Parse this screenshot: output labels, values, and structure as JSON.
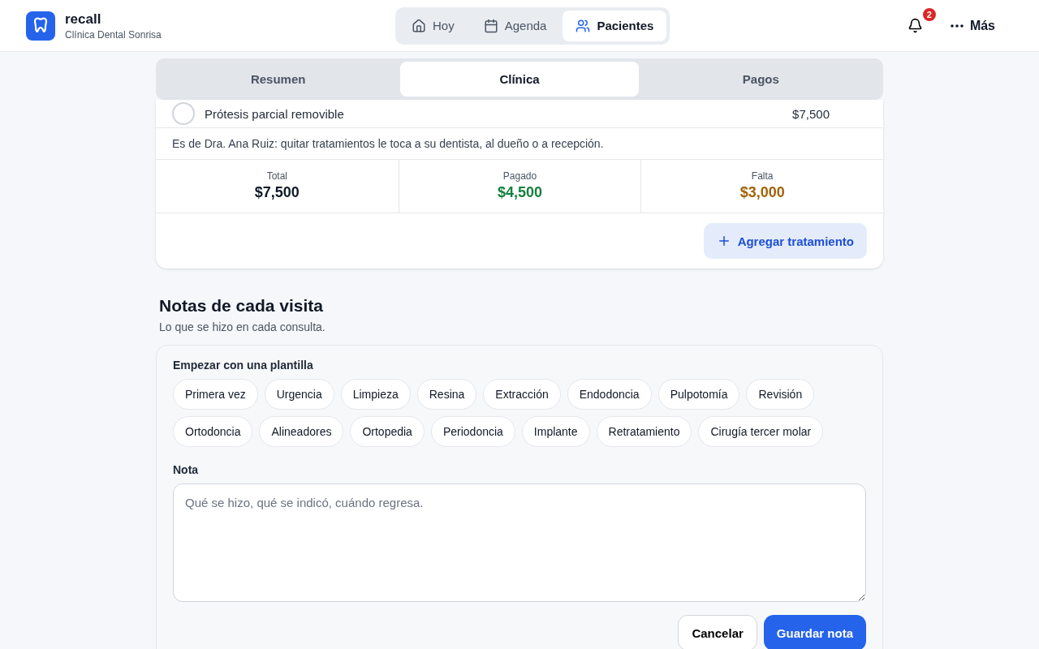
{
  "app": {
    "name": "recall",
    "clinic": "Clínica Dental Sonrisa"
  },
  "nav": [
    {
      "label": "Hoy",
      "kind": "home",
      "selected": false
    },
    {
      "label": "Agenda",
      "kind": "calendar",
      "selected": false
    },
    {
      "label": "Pacientes",
      "kind": "users",
      "selected": true
    }
  ],
  "notifications": {
    "count": "2"
  },
  "more": {
    "label": "Más"
  },
  "section_tabs": [
    {
      "label": "Resumen",
      "selected": false
    },
    {
      "label": "Clínica",
      "selected": true
    },
    {
      "label": "Pagos",
      "selected": false
    }
  ],
  "treatments": [
    {
      "name": "Prótesis parcial removible",
      "price": "$7,500",
      "checked": false
    }
  ],
  "owner_note": "Es de Dra. Ana Ruiz: quitar tratamientos le toca a su dentista, al dueño o a recepción.",
  "totals": [
    {
      "label": "Total",
      "value": "$7,500",
      "kind": "neutral"
    },
    {
      "label": "Pagado",
      "value": "$4,500",
      "kind": "paid"
    },
    {
      "label": "Falta",
      "value": "$3,000",
      "kind": "due"
    }
  ],
  "add_button": "Agregar tratamiento",
  "notes": {
    "title": "Notas de cada visita",
    "subtitle": "Lo que se hizo en cada consulta.",
    "templates_label": "Empezar con una plantilla",
    "templates": [
      [
        "Primera vez",
        "Urgencia",
        "Limpieza",
        "Resina",
        "Extracción",
        "Endodoncia",
        "Pulpotomía",
        "Revisión"
      ],
      [
        "Ortodoncia",
        "Alineadores",
        "Ortopedia",
        "Periodoncia",
        "Implante",
        "Retratamiento",
        "Cirugía tercer molar"
      ]
    ],
    "note_label": "Nota",
    "placeholder": "Qué se hizo, qué se indicó, cuándo regresa.",
    "cancel": "Cancelar",
    "save": "Guardar nota"
  }
}
